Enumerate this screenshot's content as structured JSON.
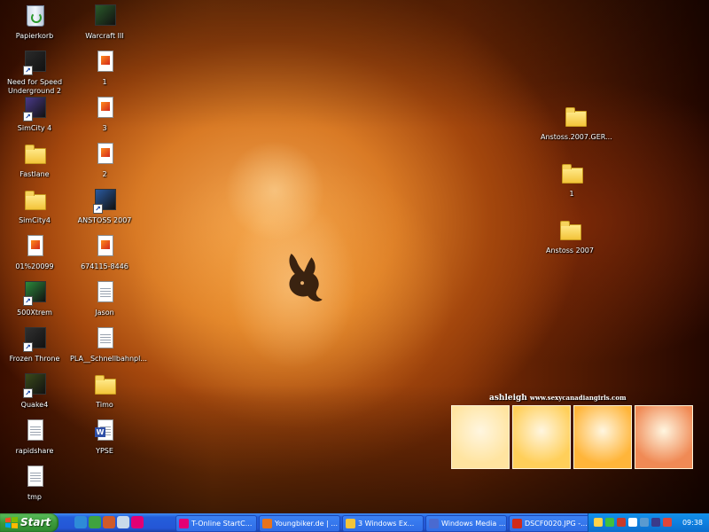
{
  "desktop": {
    "icons": [
      {
        "label": "Papierkorb",
        "icon": "recycle-bin-icon",
        "kind": "recycle"
      },
      {
        "label": "Need for Speed Underground 2",
        "icon": "nfs-icon",
        "kind": "app",
        "color": "#2a2a2a",
        "shortcut": true
      },
      {
        "label": "SimCity 4",
        "icon": "simcity-icon",
        "kind": "app",
        "color": "#4a3a8a",
        "shortcut": true
      },
      {
        "label": "Fastlane",
        "icon": "folder-icon",
        "kind": "folder"
      },
      {
        "label": "SimCity4",
        "icon": "folder-icon",
        "kind": "folder"
      },
      {
        "label": "01%20099",
        "icon": "image-file-icon",
        "kind": "img"
      },
      {
        "label": "500Xtrem",
        "icon": "500xtrem-icon",
        "kind": "app",
        "color": "#2c8a3c",
        "shortcut": true
      },
      {
        "label": "Frozen Throne",
        "icon": "frozen-throne-icon",
        "kind": "app",
        "color": "#303030",
        "shortcut": true
      },
      {
        "label": "Quake4",
        "icon": "quake4-icon",
        "kind": "app",
        "color": "#3a4a1a",
        "shortcut": true
      },
      {
        "label": "rapidshare",
        "icon": "text-file-icon",
        "kind": "doc"
      },
      {
        "label": "tmp",
        "icon": "text-file-icon",
        "kind": "doc"
      },
      {
        "label": "Warcraft III",
        "icon": "warcraft-icon",
        "kind": "app",
        "color": "#2a5a2a"
      },
      {
        "label": "1",
        "icon": "image-file-icon",
        "kind": "img"
      },
      {
        "label": "3",
        "icon": "image-file-icon",
        "kind": "img"
      },
      {
        "label": "2",
        "icon": "image-file-icon",
        "kind": "img"
      },
      {
        "label": "ANSTOSS 2007",
        "icon": "anstoss-icon",
        "kind": "app",
        "color": "#2a5aa0",
        "shortcut": true
      },
      {
        "label": "674115-8446",
        "icon": "image-file-icon",
        "kind": "img"
      },
      {
        "label": "Jason",
        "icon": "text-file-icon",
        "kind": "doc"
      },
      {
        "label": "PLA__Schnellbahnpl...",
        "icon": "document-icon",
        "kind": "doc"
      },
      {
        "label": "Timo",
        "icon": "folder-icon",
        "kind": "folder"
      },
      {
        "label": "YPSE",
        "icon": "word-document-icon",
        "kind": "word"
      },
      {
        "label": "Anstoss.2007.GER...",
        "icon": "folder-icon",
        "kind": "folder"
      },
      {
        "label": "1",
        "icon": "folder-icon",
        "kind": "folder"
      },
      {
        "label": "Anstoss 2007",
        "icon": "folder-icon",
        "kind": "folder"
      }
    ],
    "wallpaper": {
      "banner_name": "ashleigh",
      "banner_url": "www.sexycanadiangirls.com",
      "thumbnails": 4,
      "thumb_colors": [
        "#ffe4a0",
        "#ffcf5a",
        "#ffb53a",
        "#f08a55"
      ]
    }
  },
  "taskbar": {
    "start_label": "Start",
    "quick_launch": [
      {
        "icon": "ie-icon",
        "color": "#2e8bd8"
      },
      {
        "icon": "messenger-icon",
        "color": "#3fa33f"
      },
      {
        "icon": "windows-media-icon",
        "color": "#d05a2a"
      },
      {
        "icon": "show-desktop-icon",
        "color": "#c9d9ea"
      },
      {
        "icon": "t-online-icon",
        "color": "#e20074"
      }
    ],
    "tasks": [
      {
        "label": "T-Online StartC...",
        "icon": "t-online-icon",
        "color": "#e20074"
      },
      {
        "label": "Youngbiker.de | ...",
        "icon": "firefox-icon",
        "color": "#e8731c"
      },
      {
        "label": "3 Windows Ex...",
        "icon": "folder-icon",
        "color": "#f3c43a"
      },
      {
        "label": "Windows Media ...",
        "icon": "windows-media-icon",
        "color": "#4a6ad0"
      },
      {
        "label": "DSCF0020.JPG -...",
        "icon": "image-viewer-icon",
        "color": "#d02a1a"
      }
    ],
    "clock": "09:38",
    "tray_icon_colors": [
      "#ffd24a",
      "#3fbf3f",
      "#c83a2a",
      "#ffffff",
      "#5a9ad0",
      "#3a3a8a",
      "#e0463a"
    ]
  }
}
